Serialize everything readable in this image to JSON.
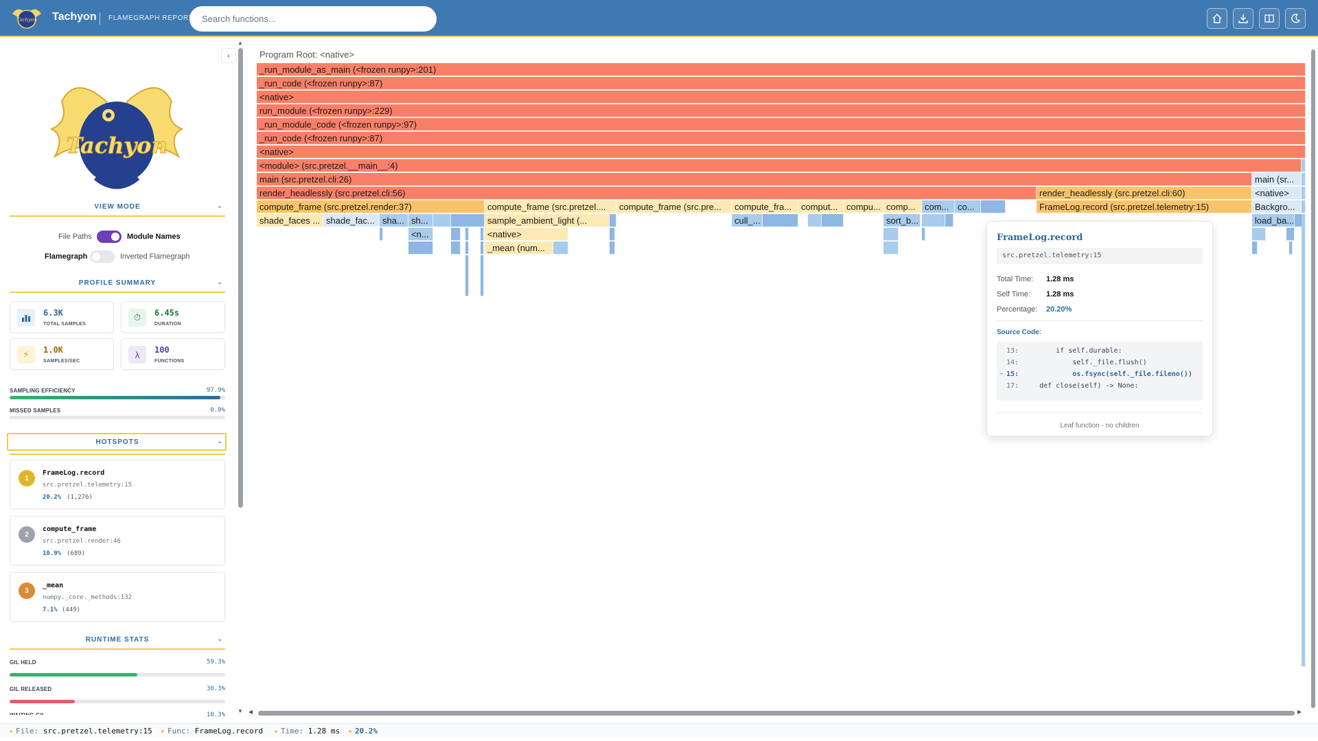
{
  "header": {
    "app_name": "Tachyon",
    "report_label": "FLAMEGRAPH REPORT",
    "search_placeholder": "Search functions...",
    "buttons": [
      "home-icon",
      "download-icon",
      "book-icon",
      "moon-icon"
    ]
  },
  "sidebar": {
    "logo_text": "Tachyon",
    "view_mode": {
      "title": "VIEW MODE",
      "file_paths_label": "File Paths",
      "module_names_label": "Module Names",
      "module_names_on": true,
      "flamegraph_label": "Flamegraph",
      "inverted_label": "Inverted Flamegraph",
      "inverted_on": false
    },
    "summary": {
      "title": "PROFILE SUMMARY",
      "cards": [
        {
          "value": "6.3K",
          "label": "TOTAL SAMPLES",
          "icon": "bar-chart-icon",
          "color": "#2c6aa0"
        },
        {
          "value": "6.45s",
          "label": "DURATION",
          "icon": "stopwatch-icon",
          "color": "#1f7a3a"
        },
        {
          "value": "1.0K",
          "label": "SAMPLES/SEC",
          "icon": "lightning-icon",
          "color": "#9a6b00"
        },
        {
          "value": "100",
          "label": "FUNCTIONS",
          "icon": "lambda-icon",
          "color": "#5b3ca8"
        }
      ],
      "efficiency_label": "SAMPLING EFFICIENCY",
      "efficiency_value": "97.9%",
      "efficiency_fraction": 0.979,
      "missed_label": "MISSED SAMPLES",
      "missed_value": "0.0%",
      "missed_fraction": 0.0
    },
    "hotspots": {
      "title": "HOTSPOTS",
      "items": [
        {
          "rank": "1",
          "name": "FrameLog.record",
          "location": "src.pretzel.telemetry:15",
          "percent": "20.2%",
          "count": "(1,276)",
          "color": "#e0b52c"
        },
        {
          "rank": "2",
          "name": "compute_frame",
          "location": "src.pretzel.render:46",
          "percent": "10.9%",
          "count": "(689)",
          "color": "#9ca3af"
        },
        {
          "rank": "3",
          "name": "_mean",
          "location": "numpy._core._methods:132",
          "percent": "7.1%",
          "count": "(449)",
          "color": "#d98a3a"
        }
      ]
    },
    "runtime": {
      "title": "RUNTIME STATS",
      "stats": [
        {
          "label": "GIL HELD",
          "value": "59.3%",
          "fraction": 0.593,
          "color": "#34b36b"
        },
        {
          "label": "GIL RELEASED",
          "value": "30.3%",
          "fraction": 0.303,
          "color": "#e35d6a"
        },
        {
          "label": "WAITING GIL",
          "value": "10.3%",
          "fraction": 0.103,
          "color": "#f2c94c"
        }
      ]
    }
  },
  "flamegraph": {
    "root_label": "Program Root: <native>",
    "frames": {
      "r1": "_run_module_as_main (<frozen runpy>:201)",
      "r2": "_run_code (<frozen runpy>:87)",
      "r3": "<native>",
      "r4": "run_module (<frozen runpy>:229)",
      "r5": "_run_module_code (<frozen runpy>:97)",
      "r6": "_run_code (<frozen runpy>:87)",
      "r7": "<native>",
      "r8": "<module> (src.pretzel.__main__:4)",
      "r9a": "main (src.pretzel.cli:26)",
      "r9b": "main (sr...",
      "r10a": "render_headlessly (src.pretzel.cli:56)",
      "r10b": "render_headlessly (src.pretzel.cli:60)",
      "r10c": "<native>",
      "r11a": "compute_frame (src.pretzel.render:37)",
      "r11b": "compute_frame (src.pretzel....",
      "r11c": "compute_frame (src.pre...",
      "r11d": "compute_fra...",
      "r11e": "comput...",
      "r11f": "compu...",
      "r11g": "comp...",
      "r11h": "com...",
      "r11i": "co...",
      "r11j": "FrameLog.record (src.pretzel.telemetry:15)",
      "r11k": "Backgro...",
      "r12a": "shade_faces ...",
      "r12b": "shade_fac...",
      "r12c": "sha...",
      "r12d": "sh...",
      "r12e": "sample_ambient_light (...",
      "r12f": "cull_...",
      "r12g": "sort_b...",
      "r12h": "load_ba...",
      "r13a": "<n...",
      "r13b": "<native>",
      "r14a": "_mean (num..."
    }
  },
  "tooltip": {
    "title": "FrameLog.record",
    "location": "src.pretzel.telemetry:15",
    "total_time_label": "Total Time:",
    "total_time": "1.28 ms",
    "self_time_label": "Self Time:",
    "self_time": "1.28 ms",
    "percentage_label": "Percentage:",
    "percentage": "20.20%",
    "source_label": "Source Code:",
    "code": [
      {
        "num": "13:",
        "text": "        if self.durable:",
        "active": false
      },
      {
        "num": "14:",
        "text": "            self._file.flush()",
        "active": false
      },
      {
        "num": "15:",
        "text": "            os.fsync(self._file.fileno())",
        "active": true
      },
      {
        "num": "17:",
        "text": "    def close(self) -> None:",
        "active": false
      }
    ],
    "leaf_note": "Leaf function - no children"
  },
  "status": {
    "file_label": "File:",
    "file": "src.pretzel.telemetry:15",
    "func_label": "Func:",
    "func": "FrameLog.record",
    "time_label": "Time:",
    "time": "1.28 ms",
    "percent": "20.2%"
  }
}
